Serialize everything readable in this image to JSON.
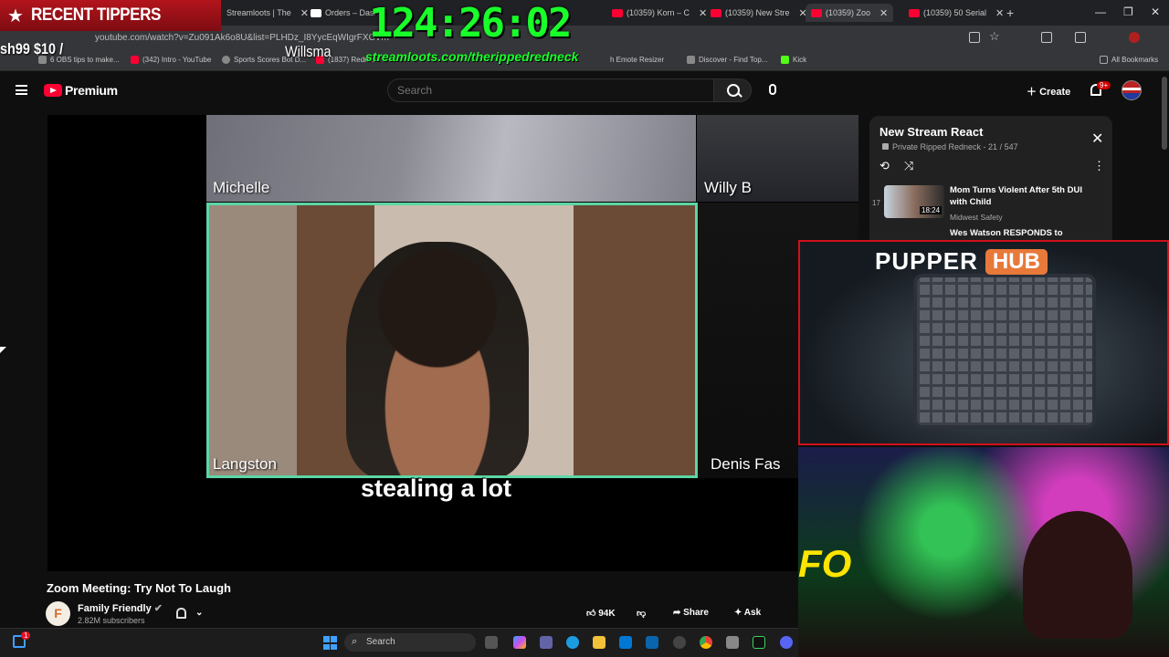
{
  "overlay": {
    "recent_tippers": "RECENT TIPPERS",
    "tipper": "sh99 $10 /",
    "tipper_name": "Willsma",
    "timer": "124:26:02",
    "promo_url": "streamloots.com/therippedredneck"
  },
  "browser": {
    "tabs": [
      {
        "label": "Streamloots | The",
        "favicon": "streamloots"
      },
      {
        "label": "Orders – Dash",
        "favicon": "dashboard"
      },
      {
        "label": "(10359) Korn – C",
        "favicon": "youtube"
      },
      {
        "label": "(10359) New Stre",
        "favicon": "youtube"
      },
      {
        "label": "(10359) Zoo",
        "favicon": "youtube"
      },
      {
        "label": "(10359) 50 Serial",
        "favicon": "youtube"
      }
    ],
    "url": "youtube.com/watch?v=Zu091Ak6o8U&list=PLHDz_I8YycEqWIgrFXCVm",
    "bookmarks": [
      {
        "label": "6 OBS tips to make..."
      },
      {
        "label": "(342) Intro - YouTube"
      },
      {
        "label": "Sports Scores Bot D..."
      },
      {
        "label": "(1837) Redn..."
      },
      {
        "label": "h Emote Resizer"
      },
      {
        "label": "Discover - Find Top..."
      },
      {
        "label": "Kick"
      }
    ],
    "all_bookmarks": "All Bookmarks"
  },
  "youtube": {
    "brand": "Premium",
    "search_placeholder": "Search",
    "create_label": "Create",
    "notification_count": "9+",
    "video": {
      "participants": [
        "Michelle",
        "Willy B",
        "Langston",
        "Denis Fas"
      ],
      "caption": "stealing a lot"
    },
    "title": "Zoom Meeting: Try Not To Laugh",
    "channel": {
      "name": "Family Friendly",
      "subscribers": "2.82M subscribers",
      "avatar_letter": "F"
    },
    "actions": {
      "likes": "94K",
      "share": "Share",
      "ask": "Ask"
    },
    "playlist": {
      "title": "New Stream React",
      "subtitle": "Private Ripped Redneck - 21 / 547",
      "items": [
        {
          "index": "17",
          "title": "Mom Turns Violent After 5th DUI with Child",
          "channel": "Midwest Safety",
          "duration": "18:24"
        },
        {
          "title": "Wes Watson RESPONDS to"
        }
      ]
    }
  },
  "stream": {
    "pupper_word": "PUPPER",
    "hub_word": "HUB",
    "cam_text": "FO"
  },
  "taskbar": {
    "search_label": "Search",
    "notification_badge": "1"
  }
}
